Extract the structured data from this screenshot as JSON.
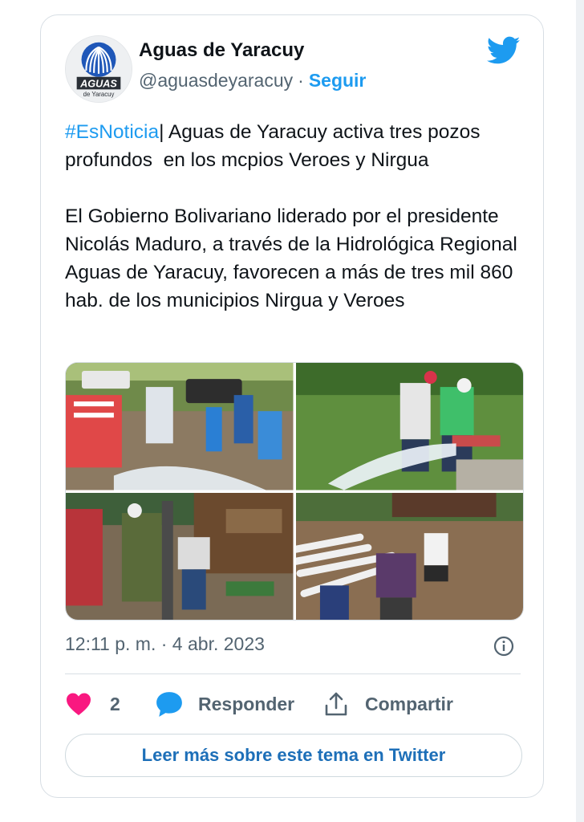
{
  "account": {
    "name": "Aguas de Yaracuy",
    "handle": "@aguasdeyaracuy",
    "separator": "·",
    "follow_label": "Seguir",
    "avatar_text_main": "AGUAS",
    "avatar_text_sub": "de Yaracuy"
  },
  "tweet": {
    "hashtag": "#EsNoticia",
    "line1_rest": "| Aguas de Yaracuy activa tres pozos profundos  en los mcpios Veroes y Nirgua",
    "paragraph2": "El Gobierno Bolivariano liderado por el presidente Nicolás Maduro, a través de la Hidrológica Regional Aguas de Yaracuy, favorecen a más de tres mil 860 hab. de los municipios Nirgua y Veroes",
    "timestamp": "12:11 p. m. · 4 abr. 2023"
  },
  "actions": {
    "likes_count": "2",
    "reply_label": "Responder",
    "share_label": "Compartir"
  },
  "read_more_label": "Leer más sobre este tema en Twitter",
  "colors": {
    "brand": "#1d9bf0",
    "like": "#f91880",
    "text_secondary": "#536471"
  },
  "icons": [
    "twitter-bird-icon",
    "info-icon",
    "heart-icon",
    "reply-bubble-icon",
    "share-icon"
  ]
}
